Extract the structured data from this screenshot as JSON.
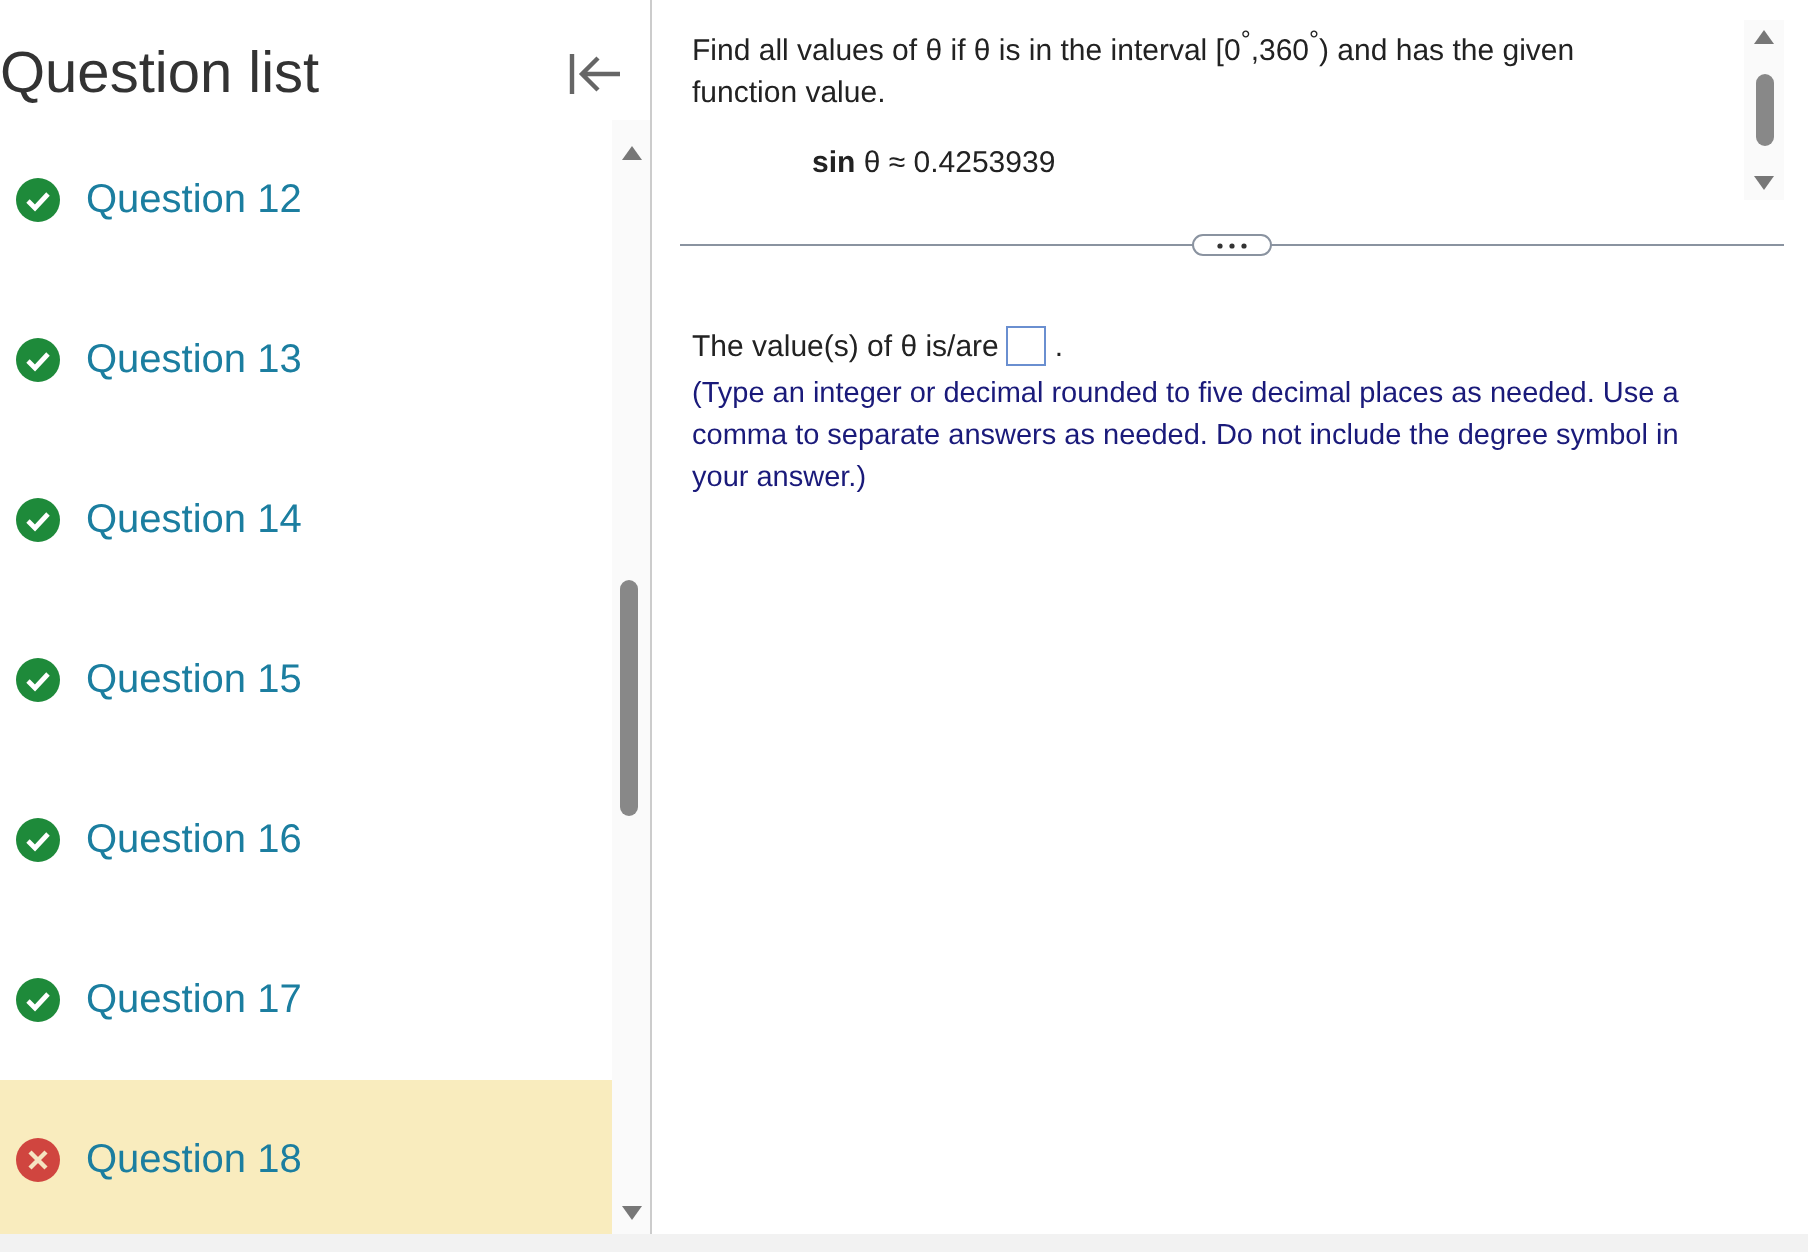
{
  "sidebar": {
    "title": "Question list",
    "questions": [
      {
        "label": "Question 12",
        "kind": "correct",
        "selected": false
      },
      {
        "label": "Question 13",
        "kind": "correct",
        "selected": false
      },
      {
        "label": "Question 14",
        "kind": "correct",
        "selected": false
      },
      {
        "label": "Question 15",
        "kind": "correct",
        "selected": false
      },
      {
        "label": "Question 16",
        "kind": "correct",
        "selected": false
      },
      {
        "label": "Question 17",
        "kind": "correct",
        "selected": false
      },
      {
        "label": "Question 18",
        "kind": "incorrect",
        "selected": true
      }
    ]
  },
  "question": {
    "prompt": "Find all values of θ if θ is in the interval [0$^{°}$,360$^{°}$) and has the given function value.",
    "given": "**sin** θ ≈ 0.4253939"
  },
  "answer": {
    "label": "The value(s) of θ is/are",
    "after": ".",
    "instructions": "(Type an integer or decimal rounded to five decimal places as needed. Use a comma to separate answers as needed. Do not include the degree symbol in your answer.)"
  }
}
